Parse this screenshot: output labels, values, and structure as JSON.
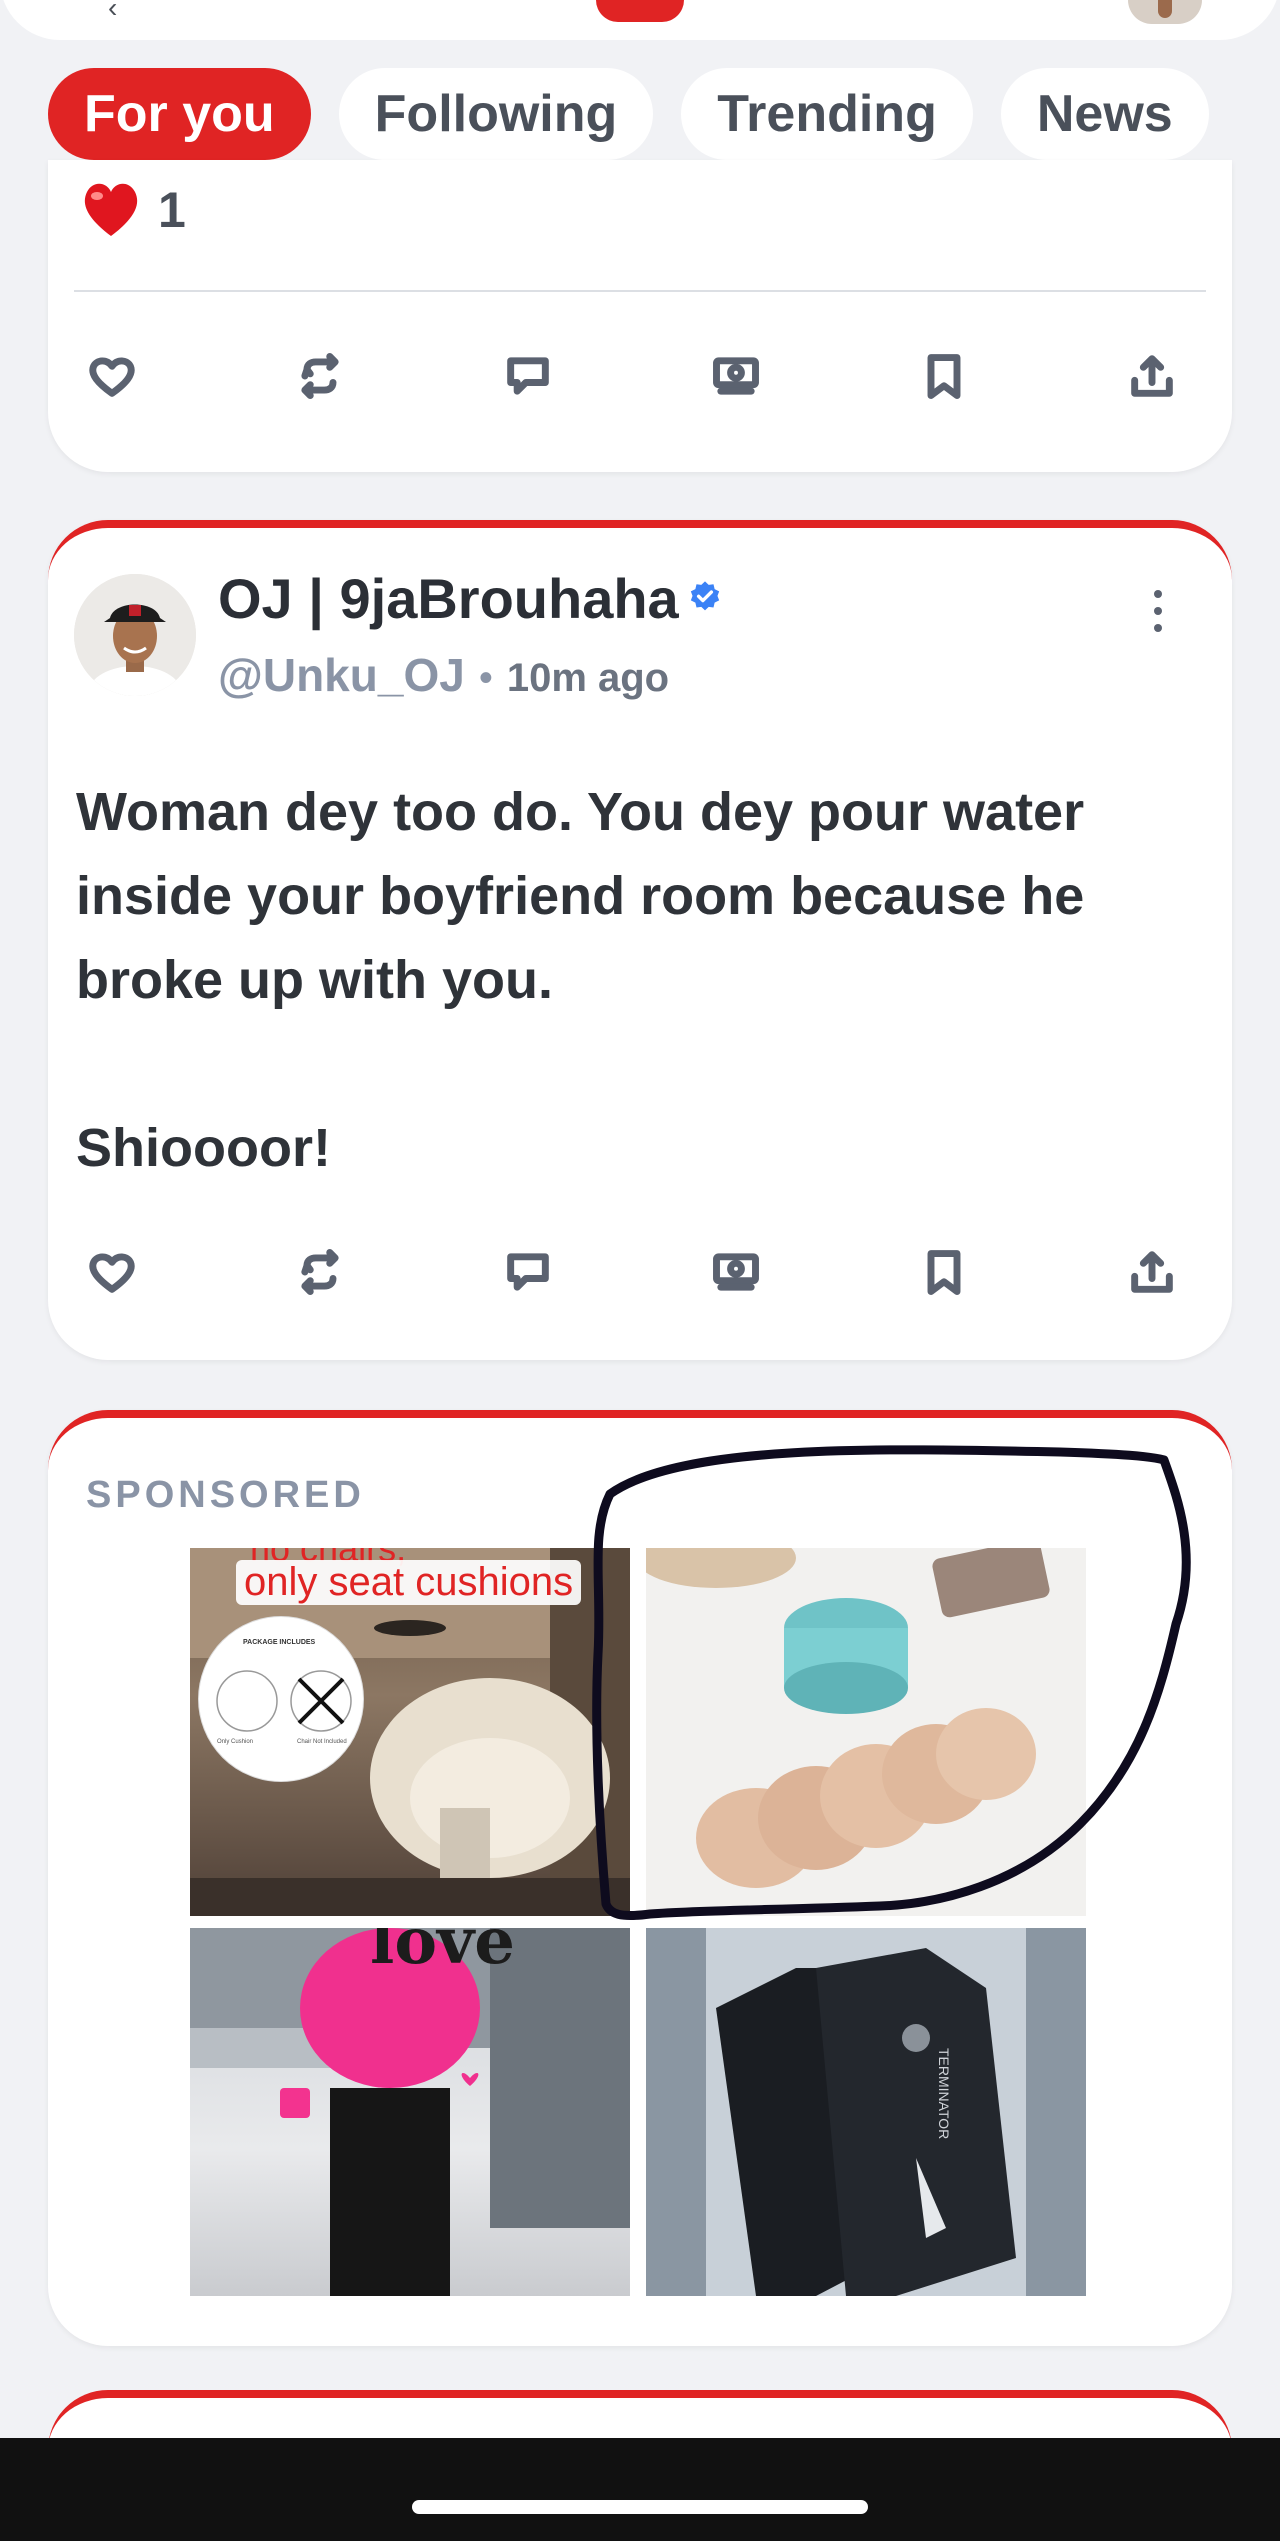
{
  "tabs": [
    {
      "label": "For you",
      "active": true
    },
    {
      "label": "Following",
      "active": false
    },
    {
      "label": "Trending",
      "active": false
    },
    {
      "label": "News",
      "active": false
    }
  ],
  "prev_post": {
    "reaction_emoji": "red-heart",
    "reaction_count": "1"
  },
  "post": {
    "author": "OJ | 9jaBrouhaha",
    "handle": "@Unku_OJ",
    "separator": "•",
    "time": "10m ago",
    "text": "Woman dey too do. You dey pour water inside your boyfriend room because he broke up with you.\n\nShioooor!"
  },
  "sponsored": {
    "label": "SPONSORED",
    "ad1_caption_top": "no chairs,",
    "ad1_caption": "only seat cushions",
    "ad1_pkg_title": "PACKAGE INCLUDES",
    "ad1_pkg_left": "Only Cushion",
    "ad1_pkg_right": "Chair Not Included",
    "ad3_text": "love",
    "ad4_label": "TERMINATOR"
  },
  "icons": [
    "like-icon",
    "repost-icon",
    "comment-icon",
    "tip-icon",
    "bookmark-icon",
    "share-icon"
  ],
  "colors": {
    "accent": "#e02424",
    "verified": "#3b82f6",
    "muted": "#8a94a6"
  }
}
